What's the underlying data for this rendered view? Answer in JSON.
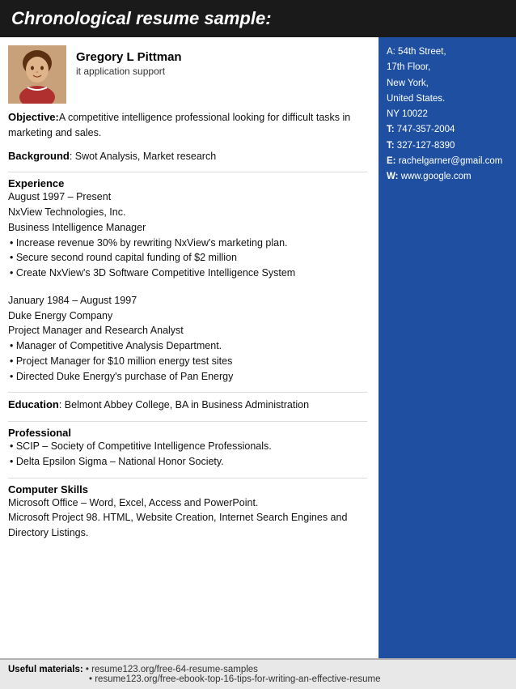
{
  "title": "Chronological resume sample:",
  "person": {
    "name": "Gregory L Pittman",
    "job_title": "it application support",
    "avatar_description": "Woman photo"
  },
  "contact": {
    "address_line1": "A: 54th Street,",
    "address_line2": "17th Floor,",
    "address_line3": "New York,",
    "address_line4": "United States.",
    "address_line5": "NY 10022",
    "phone1_label": "T:",
    "phone1": "747-357-2004",
    "phone2_label": "T:",
    "phone2": "327-127-8390",
    "email_label": "E:",
    "email": "rachelgarner@gmail.com",
    "web_label": "W:",
    "web": "www.google.com"
  },
  "objective": {
    "label": "Objective:",
    "text": "A competitive intelligence professional looking for difficult tasks in marketing and sales."
  },
  "background": {
    "label": "Background",
    "text": ": Swot Analysis, Market research"
  },
  "experience": {
    "label": "Experience",
    "job1": {
      "dates": "August 1997 – Present",
      "company": "NxView Technologies, Inc.",
      "role": "Business Intelligence Manager",
      "bullets": [
        "• Increase revenue 30% by rewriting NxView's marketing plan.",
        "• Secure second round capital funding of $2 million",
        "• Create NxView's 3D Software Competitive Intelligence System"
      ]
    },
    "job2": {
      "dates": "January 1984 – August 1997",
      "company": "Duke Energy Company",
      "role": "Project Manager and Research Analyst",
      "bullets": [
        "• Manager of Competitive Analysis Department.",
        "• Project Manager for $10 million energy test sites",
        "• Directed Duke Energy's purchase of Pan Energy"
      ]
    }
  },
  "education": {
    "label": "Education",
    "text": ": Belmont Abbey College, BA in Business Administration"
  },
  "professional": {
    "label": "Professional",
    "bullets": [
      "• SCIP – Society of Competitive Intelligence Professionals.",
      "• Delta Epsilon Sigma – National Honor Society."
    ]
  },
  "computer_skills": {
    "label": "Computer Skills",
    "lines": [
      "Microsoft Office – Word, Excel, Access and PowerPoint.",
      "Microsoft Project 98. HTML, Website Creation, Internet Search Engines and Directory Listings."
    ]
  },
  "footer": {
    "useful_label": "Useful materials:",
    "link1": "• resume123.org/free-64-resume-samples",
    "link2": "• resume123.org/free-ebook-top-16-tips-for-writing-an-effective-resume"
  }
}
